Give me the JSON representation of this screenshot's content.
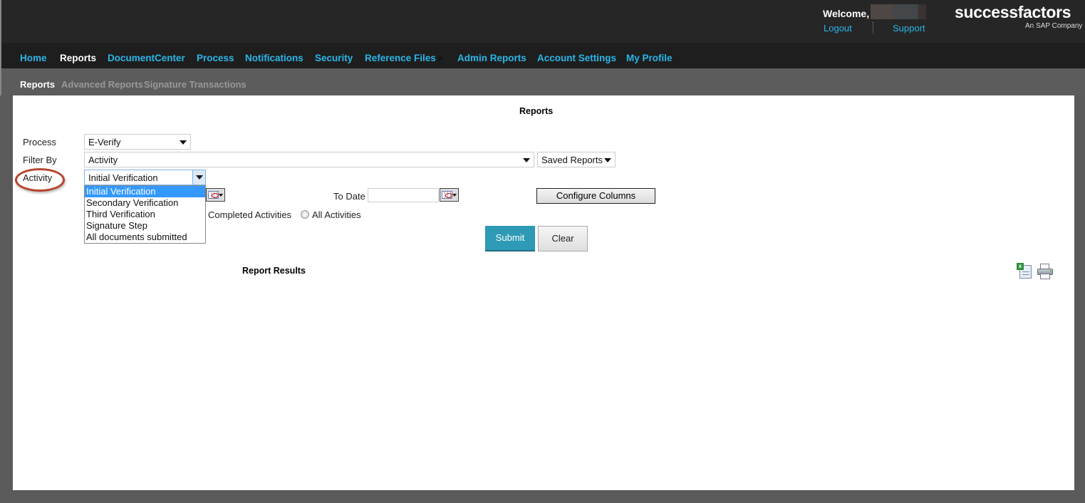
{
  "header": {
    "welcome": "Welcome,",
    "logout": "Logout",
    "support": "Support",
    "logo": "successfactors",
    "logo_tagline": "An SAP Company"
  },
  "nav": {
    "items": [
      {
        "label": "Home"
      },
      {
        "label": "Reports",
        "active": true
      },
      {
        "label": "DocumentCenter"
      },
      {
        "label": "Process"
      },
      {
        "label": "Notifications"
      },
      {
        "label": "Security"
      },
      {
        "label": "Reference Files"
      },
      {
        "label": "Admin Reports"
      },
      {
        "label": "Account Settings"
      },
      {
        "label": "My Profile"
      }
    ]
  },
  "subnav": {
    "items": [
      {
        "label": "Reports",
        "active": true
      },
      {
        "label": "Advanced Reports"
      },
      {
        "label": "Signature Transactions"
      }
    ]
  },
  "form": {
    "title": "Reports",
    "process_label": "Process",
    "process_value": "E-Verify",
    "filter_label": "Filter By",
    "filter_value": "Activity",
    "saved_reports": "Saved Reports",
    "activity_label": "Activity",
    "activity_value": "Initial Verification",
    "activity_options": [
      "Initial Verification",
      "Secondary Verification",
      "Third Verification",
      "Signature Step",
      "All documents submitted"
    ],
    "to_date_label": "To Date",
    "to_date_value": "",
    "configure_columns": "Configure Columns",
    "radio_completed": "Completed Activities",
    "radio_all": "All Activities",
    "submit": "Submit",
    "clear": "Clear"
  },
  "results": {
    "title": "Report Results"
  },
  "colors": {
    "accent": "#2e9ab5",
    "nav_link": "#29b6e8",
    "highlight": "#3399ff",
    "annotation": "#b5452c"
  }
}
